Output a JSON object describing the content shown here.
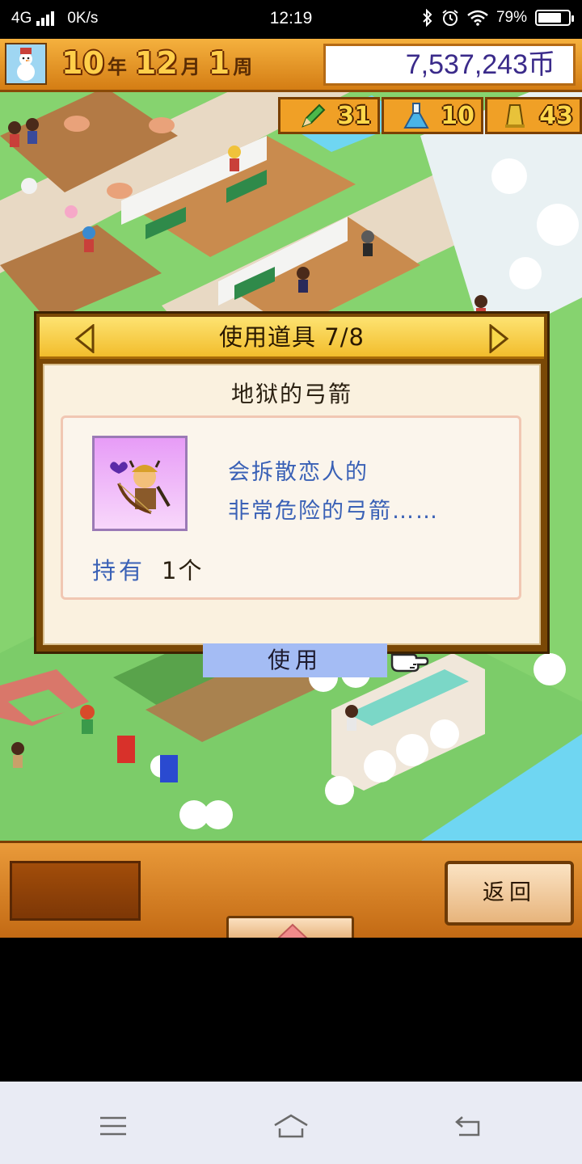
{
  "status_bar": {
    "network": "4G",
    "speed": "0K/s",
    "time": "12:19",
    "battery_percent": "79%",
    "battery_level": 0.79,
    "icons": [
      "signal-icon",
      "bluetooth-icon",
      "alarm-icon",
      "wifi-icon",
      "battery-icon"
    ]
  },
  "hud": {
    "year_num": "10",
    "year_unit": "年",
    "month_num": "12",
    "month_unit": "月",
    "week_num": "1",
    "week_unit": "周",
    "money": "7,537,243币",
    "stats": [
      {
        "icon": "pencil-icon",
        "value": "31"
      },
      {
        "icon": "flask-icon",
        "value": "10"
      },
      {
        "icon": "trophy-icon",
        "value": "43"
      }
    ]
  },
  "dialog": {
    "title": "使用道具 7/8",
    "item_name": "地狱的弓箭",
    "item_icon": "archer-item-icon",
    "description_line1": "会拆散恋人的",
    "description_line2": "非常危险的弓箭……",
    "own_label": "持有",
    "own_value": "1个",
    "use_label": "使用"
  },
  "bottom_hud": {
    "back_label": "返回"
  },
  "navbar": {
    "icons": [
      "menu-icon",
      "home-icon",
      "back-icon"
    ]
  },
  "colors": {
    "hud_orange": "#e9992e",
    "dialog_frame": "#7a4806",
    "dialog_title": "#f7cf4a",
    "desc_blue": "#3a61b6",
    "use_button": "#a4bcf4",
    "water": "#6fd6f2"
  }
}
